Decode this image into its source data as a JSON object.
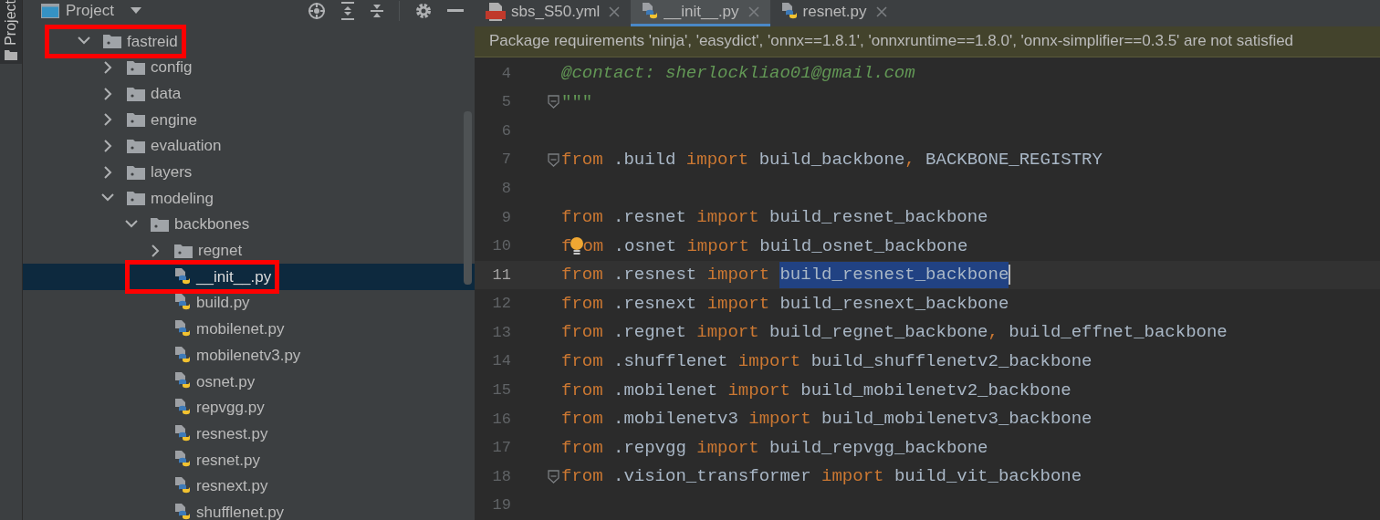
{
  "side_strip": {
    "label": "Project"
  },
  "project_panel": {
    "title": "Project",
    "tree": [
      {
        "label": "fastreid",
        "kind": "folder",
        "expanded": true,
        "selected": false,
        "highlighted": true,
        "children": [
          {
            "label": "config",
            "kind": "folder",
            "expanded": false,
            "selected": false,
            "highlighted": false
          },
          {
            "label": "data",
            "kind": "folder",
            "expanded": false,
            "selected": false,
            "highlighted": false
          },
          {
            "label": "engine",
            "kind": "folder",
            "expanded": false,
            "selected": false,
            "highlighted": false
          },
          {
            "label": "evaluation",
            "kind": "folder",
            "expanded": false,
            "selected": false,
            "highlighted": false
          },
          {
            "label": "layers",
            "kind": "folder",
            "expanded": false,
            "selected": false,
            "highlighted": false
          },
          {
            "label": "modeling",
            "kind": "folder",
            "expanded": true,
            "selected": false,
            "highlighted": false,
            "children": [
              {
                "label": "backbones",
                "kind": "folder",
                "expanded": true,
                "selected": false,
                "highlighted": false,
                "children": [
                  {
                    "label": "regnet",
                    "kind": "folder",
                    "expanded": false,
                    "selected": false,
                    "highlighted": false
                  },
                  {
                    "label": "__init__.py",
                    "kind": "python",
                    "selected": true,
                    "highlighted": true
                  },
                  {
                    "label": "build.py",
                    "kind": "python",
                    "selected": false,
                    "highlighted": false
                  },
                  {
                    "label": "mobilenet.py",
                    "kind": "python",
                    "selected": false,
                    "highlighted": false
                  },
                  {
                    "label": "mobilenetv3.py",
                    "kind": "python",
                    "selected": false,
                    "highlighted": false
                  },
                  {
                    "label": "osnet.py",
                    "kind": "python",
                    "selected": false,
                    "highlighted": false
                  },
                  {
                    "label": "repvgg.py",
                    "kind": "python",
                    "selected": false,
                    "highlighted": false
                  },
                  {
                    "label": "resnest.py",
                    "kind": "python",
                    "selected": false,
                    "highlighted": false
                  },
                  {
                    "label": "resnet.py",
                    "kind": "python",
                    "selected": false,
                    "highlighted": false
                  },
                  {
                    "label": "resnext.py",
                    "kind": "python",
                    "selected": false,
                    "highlighted": false
                  },
                  {
                    "label": "shufflenet.py",
                    "kind": "python",
                    "selected": false,
                    "highlighted": false
                  }
                ]
              }
            ]
          }
        ]
      }
    ]
  },
  "tabs": [
    {
      "label": "sbs_S50.yml",
      "kind": "yml",
      "selected": false
    },
    {
      "label": "__init__.py",
      "kind": "python",
      "selected": true
    },
    {
      "label": "resnet.py",
      "kind": "python",
      "selected": false
    }
  ],
  "notification": "Package requirements 'ninja', 'easydict', 'onnx==1.8.1', 'onnxruntime==1.8.0', 'onnx-simplifier==0.3.5' are not satisfied",
  "editor": {
    "lines": [
      {
        "number": "4",
        "current": false,
        "fold": false,
        "tokens": [
          {
            "kind": "doc",
            "text": "@contact: sherlockliao01@gmail.com"
          }
        ]
      },
      {
        "number": "5",
        "current": false,
        "fold": true,
        "tokens": [
          {
            "kind": "docquote",
            "text": "\"\"\""
          }
        ]
      },
      {
        "number": "6",
        "current": false,
        "fold": false
      },
      {
        "number": "7",
        "current": false,
        "fold": true,
        "tokens": [
          {
            "kind": "keyword",
            "text": "from"
          },
          {
            "kind": "plain",
            "text": " .build "
          },
          {
            "kind": "keyword",
            "text": "import"
          },
          {
            "kind": "plain",
            "text": " build_backbone"
          },
          {
            "kind": "keyword",
            "text": ","
          },
          {
            "kind": "plain",
            "text": " BACKBONE_REGISTRY"
          }
        ]
      },
      {
        "number": "8",
        "current": false,
        "fold": false
      },
      {
        "number": "9",
        "current": false,
        "fold": false,
        "tokens": [
          {
            "kind": "keyword",
            "text": "from"
          },
          {
            "kind": "plain",
            "text": " .resnet "
          },
          {
            "kind": "keyword",
            "text": "import"
          },
          {
            "kind": "plain",
            "text": " build_resnet_backbone"
          }
        ]
      },
      {
        "number": "10",
        "current": false,
        "fold": false,
        "tokens": [
          {
            "kind": "keyword",
            "text": "f"
          },
          {
            "kind": "bulb"
          },
          {
            "kind": "keyword",
            "text": "om"
          },
          {
            "kind": "plain",
            "text": " .osnet "
          },
          {
            "kind": "keyword",
            "text": "import"
          },
          {
            "kind": "plain",
            "text": " build_osnet_backbone"
          }
        ]
      },
      {
        "number": "11",
        "current": true,
        "fold": false,
        "tokens": [
          {
            "kind": "keyword",
            "text": "from"
          },
          {
            "kind": "plain",
            "text": " .resnest "
          },
          {
            "kind": "keyword",
            "text": "import "
          },
          {
            "kind": "selected",
            "text": "build_resnest_backbone"
          },
          {
            "kind": "caret"
          }
        ]
      },
      {
        "number": "12",
        "current": false,
        "fold": false,
        "tokens": [
          {
            "kind": "keyword",
            "text": "from"
          },
          {
            "kind": "plain",
            "text": " .resnext "
          },
          {
            "kind": "keyword",
            "text": "import"
          },
          {
            "kind": "plain",
            "text": " build_resnext_backbone"
          }
        ]
      },
      {
        "number": "13",
        "current": false,
        "fold": false,
        "tokens": [
          {
            "kind": "keyword",
            "text": "from"
          },
          {
            "kind": "plain",
            "text": " .regnet "
          },
          {
            "kind": "keyword",
            "text": "import"
          },
          {
            "kind": "plain",
            "text": " build_regnet_backbone"
          },
          {
            "kind": "keyword",
            "text": ","
          },
          {
            "kind": "plain",
            "text": " build_effnet_backbone"
          }
        ]
      },
      {
        "number": "14",
        "current": false,
        "fold": false,
        "tokens": [
          {
            "kind": "keyword",
            "text": "from"
          },
          {
            "kind": "plain",
            "text": " .shufflenet "
          },
          {
            "kind": "keyword",
            "text": "import"
          },
          {
            "kind": "plain",
            "text": " build_shufflenetv2_backbone"
          }
        ]
      },
      {
        "number": "15",
        "current": false,
        "fold": false,
        "tokens": [
          {
            "kind": "keyword",
            "text": "from"
          },
          {
            "kind": "plain",
            "text": " .mobilenet "
          },
          {
            "kind": "keyword",
            "text": "import"
          },
          {
            "kind": "plain",
            "text": " build_mobilenetv2_backbone"
          }
        ]
      },
      {
        "number": "16",
        "current": false,
        "fold": false,
        "tokens": [
          {
            "kind": "keyword",
            "text": "from"
          },
          {
            "kind": "plain",
            "text": " .mobilenetv3 "
          },
          {
            "kind": "keyword",
            "text": "import"
          },
          {
            "kind": "plain",
            "text": " build_mobilenetv3_backbone"
          }
        ]
      },
      {
        "number": "17",
        "current": false,
        "fold": false,
        "tokens": [
          {
            "kind": "keyword",
            "text": "from"
          },
          {
            "kind": "plain",
            "text": " .repvgg "
          },
          {
            "kind": "keyword",
            "text": "import"
          },
          {
            "kind": "plain",
            "text": " build_repvgg_backbone"
          }
        ]
      },
      {
        "number": "18",
        "current": false,
        "fold": true,
        "tokens": [
          {
            "kind": "keyword",
            "text": "from"
          },
          {
            "kind": "plain",
            "text": " .vision_transformer "
          },
          {
            "kind": "keyword",
            "text": "import"
          },
          {
            "kind": "plain",
            "text": " build_vit_backbone"
          }
        ]
      },
      {
        "number": "19",
        "current": false,
        "fold": false
      }
    ]
  }
}
